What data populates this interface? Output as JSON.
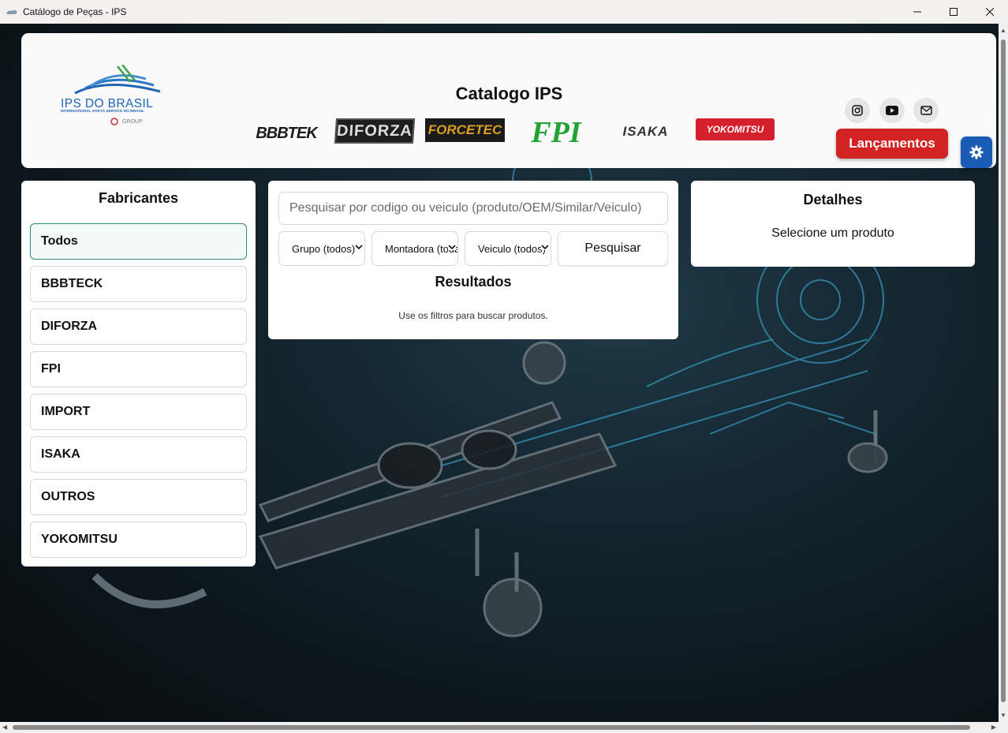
{
  "window": {
    "title": "Catálogo de Peças - IPS",
    "minimize": "—",
    "maximize": "☐",
    "close": "✕"
  },
  "header": {
    "logo": {
      "name": "IPS DO BRASIL",
      "subtitle": "INTERNATIONAL PARTS SERVICE DO BRASIL",
      "group": "GROUP"
    },
    "title": "Catalogo IPS",
    "brands": [
      {
        "name": "BBBTEK"
      },
      {
        "name": "DIFORZA"
      },
      {
        "name": "FORCETEC"
      },
      {
        "name": "FPI"
      },
      {
        "name": "ISAKA"
      },
      {
        "name": "YOKOMITSU"
      }
    ],
    "social": [
      "instagram-icon",
      "youtube-icon",
      "mail-icon"
    ],
    "launch_button": "Lançamentos",
    "settings_icon": "gear-icon"
  },
  "fabricantes": {
    "title": "Fabricantes",
    "items": [
      {
        "label": "Todos",
        "active": true
      },
      {
        "label": "BBBTECK",
        "active": false
      },
      {
        "label": "DIFORZA",
        "active": false
      },
      {
        "label": "FPI",
        "active": false
      },
      {
        "label": "IMPORT",
        "active": false
      },
      {
        "label": "ISAKA",
        "active": false
      },
      {
        "label": "OUTROS",
        "active": false
      },
      {
        "label": "YOKOMITSU",
        "active": false
      }
    ]
  },
  "search": {
    "placeholder": "Pesquisar por codigo ou veiculo (produto/OEM/Similar/Veiculo)",
    "grupo": "Grupo (todos)",
    "montadora": "Montadora (todas)",
    "veiculo": "Veiculo (todos)",
    "button": "Pesquisar",
    "results_title": "Resultados",
    "results_empty": "Use os filtros para buscar produtos."
  },
  "details": {
    "title": "Detalhes",
    "message": "Selecione um produto"
  },
  "colors": {
    "launch": "#d32222",
    "settings": "#1a5bb5",
    "active_border": "#2e8b7a",
    "brand_blue": "#1f63b5"
  }
}
